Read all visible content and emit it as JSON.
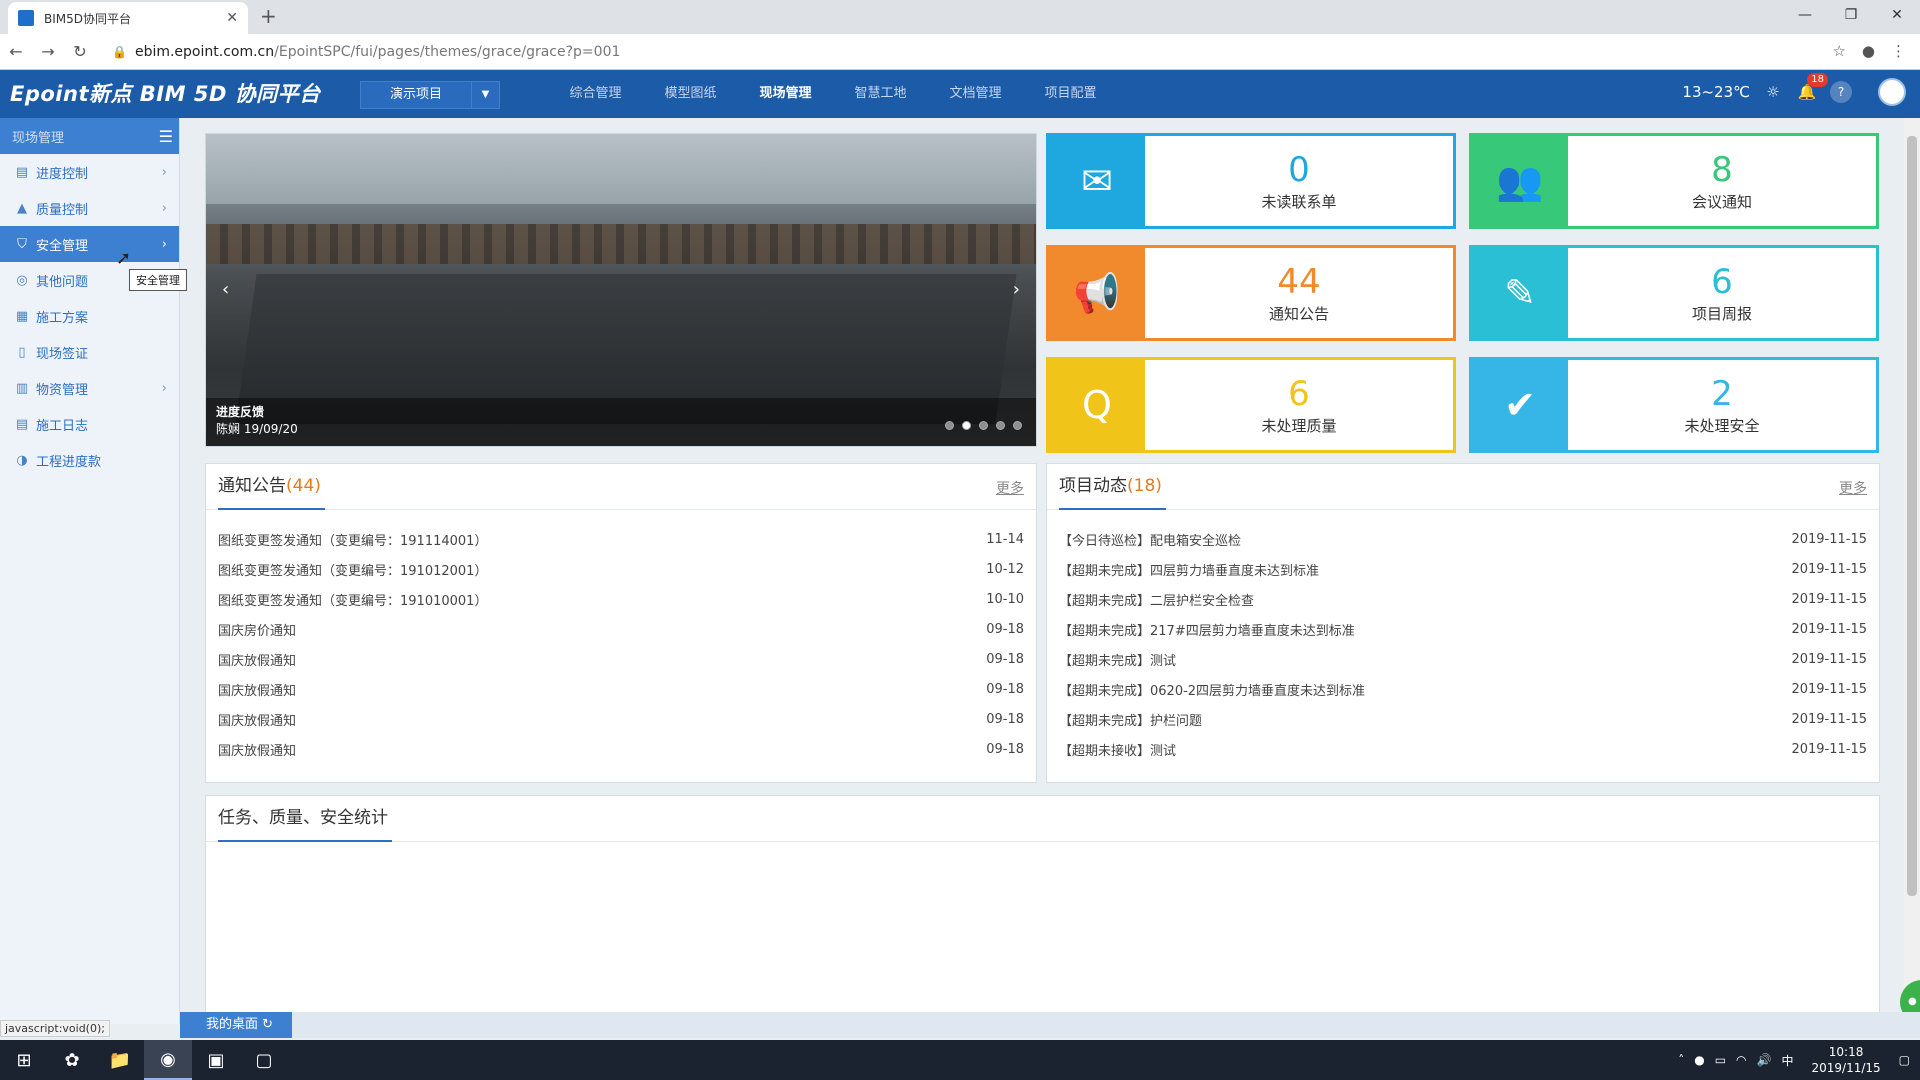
{
  "browser": {
    "tab_title": "BIM5D协同平台",
    "url_host": "ebim.epoint.com.cn",
    "url_path": "/EpointSPC/fui/pages/themes/grace/grace?p=001"
  },
  "header": {
    "logo": "Epoint新点 BIM 5D 协同平台",
    "project_select": "演示项目",
    "nav": [
      "综合管理",
      "模型图纸",
      "现场管理",
      "智慧工地",
      "文档管理",
      "项目配置"
    ],
    "active_nav": "现场管理",
    "weather": "13~23℃",
    "notifications": "18"
  },
  "sidebar": {
    "title": "现场管理",
    "items": [
      {
        "label": "进度控制",
        "icon": "progress-icon",
        "has_children": true
      },
      {
        "label": "质量控制",
        "icon": "quality-icon",
        "has_children": true
      },
      {
        "label": "安全管理",
        "icon": "shield-icon",
        "has_children": true,
        "active": true
      },
      {
        "label": "其他问题",
        "icon": "issue-icon",
        "has_children": false
      },
      {
        "label": "施工方案",
        "icon": "plan-icon",
        "has_children": false
      },
      {
        "label": "现场签证",
        "icon": "visa-icon",
        "has_children": false
      },
      {
        "label": "物资管理",
        "icon": "material-icon",
        "has_children": true
      },
      {
        "label": "施工日志",
        "icon": "log-icon",
        "has_children": false
      },
      {
        "label": "工程进度款",
        "icon": "payment-icon",
        "has_children": false
      }
    ],
    "tooltip": "安全管理"
  },
  "carousel": {
    "caption_title": "进度反馈",
    "caption_sub": "陈娴  19/09/20",
    "dots": 5,
    "active_dot": 2
  },
  "stats": [
    {
      "value": "0",
      "label": "未读联系单",
      "color": "#1fa7e0",
      "icon": "mail-icon"
    },
    {
      "value": "8",
      "label": "会议通知",
      "color": "#37c87a",
      "icon": "meeting-icon"
    },
    {
      "value": "44",
      "label": "通知公告",
      "color": "#f08a2c",
      "icon": "megaphone-icon"
    },
    {
      "value": "6",
      "label": "项目周报",
      "color": "#2bbfd6",
      "icon": "report-icon"
    },
    {
      "value": "6",
      "label": "未处理质量",
      "color": "#f0c419",
      "icon": "quality-q-icon"
    },
    {
      "value": "2",
      "label": "未处理安全",
      "color": "#35b6e6",
      "icon": "clipboard-check-icon"
    }
  ],
  "notices": {
    "title": "通知公告",
    "count": "(44)",
    "more": "更多",
    "rows": [
      {
        "title": "图纸变更签发通知（变更编号：191114001）",
        "date": "11-14"
      },
      {
        "title": "图纸变更签发通知（变更编号：191012001）",
        "date": "10-12"
      },
      {
        "title": "图纸变更签发通知（变更编号：191010001）",
        "date": "10-10"
      },
      {
        "title": "国庆房价通知",
        "date": "09-18"
      },
      {
        "title": "国庆放假通知",
        "date": "09-18"
      },
      {
        "title": "国庆放假通知",
        "date": "09-18"
      },
      {
        "title": "国庆放假通知",
        "date": "09-18"
      },
      {
        "title": "国庆放假通知",
        "date": "09-18"
      }
    ]
  },
  "dynamics": {
    "title": "项目动态",
    "count": "(18)",
    "more": "更多",
    "rows": [
      {
        "title": "【今日待巡检】配电箱安全巡检",
        "date": "2019-11-15"
      },
      {
        "title": "【超期未完成】四层剪力墙垂直度未达到标准",
        "date": "2019-11-15"
      },
      {
        "title": "【超期未完成】二层护栏安全检查",
        "date": "2019-11-15"
      },
      {
        "title": "【超期未完成】217#四层剪力墙垂直度未达到标准",
        "date": "2019-11-15"
      },
      {
        "title": "【超期未完成】测试",
        "date": "2019-11-15"
      },
      {
        "title": "【超期未完成】0620-2四层剪力墙垂直度未达到标准",
        "date": "2019-11-15"
      },
      {
        "title": "【超期未完成】护栏问题",
        "date": "2019-11-15"
      },
      {
        "title": "【超期未接收】测试",
        "date": "2019-11-15"
      }
    ]
  },
  "stats_panel": {
    "title": "任务、质量、安全统计"
  },
  "bottom": {
    "desk_tab": "我的桌面",
    "status_url": "javascript:void(0);"
  },
  "taskbar": {
    "time": "10:18",
    "date": "2019/11/15",
    "ime": "中"
  }
}
